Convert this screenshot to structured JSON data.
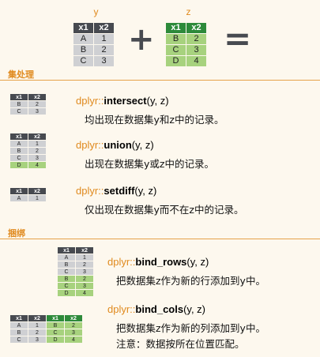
{
  "header": {
    "y_label": "y",
    "z_label": "z",
    "plus": "+",
    "equals": "="
  },
  "y_table": {
    "cols": [
      "x1",
      "x2"
    ],
    "rows": [
      [
        "A",
        "1"
      ],
      [
        "B",
        "2"
      ],
      [
        "C",
        "3"
      ]
    ]
  },
  "z_table": {
    "cols": [
      "x1",
      "x2"
    ],
    "rows": [
      [
        "B",
        "2"
      ],
      [
        "C",
        "3"
      ],
      [
        "D",
        "4"
      ]
    ]
  },
  "sections": {
    "set_ops": "集处理",
    "binding": "捆绑"
  },
  "intersect": {
    "pkg": "dplyr::",
    "name": "intersect",
    "args": "(y, z)",
    "desc": "均出现在数据集y和z中的记录。",
    "cols": [
      "x1",
      "x2"
    ],
    "rows": [
      [
        "B",
        "2"
      ],
      [
        "C",
        "3"
      ]
    ]
  },
  "union": {
    "pkg": "dplyr::",
    "name": "union",
    "args": "(y, z)",
    "desc": "出现在数据集y或z中的记录。",
    "cols": [
      "x1",
      "x2"
    ],
    "rows": [
      [
        "A",
        "1"
      ],
      [
        "B",
        "2"
      ],
      [
        "C",
        "3"
      ],
      [
        "D",
        "4"
      ]
    ]
  },
  "setdiff": {
    "pkg": "dplyr::",
    "name": "setdiff",
    "args": "(y, z)",
    "desc": "仅出现在数据集y而不在z中的记录。",
    "cols": [
      "x1",
      "x2"
    ],
    "rows": [
      [
        "A",
        "1"
      ]
    ]
  },
  "bind_rows": {
    "pkg": "dplyr::",
    "name": "bind_rows",
    "args": "(y, z)",
    "desc": "把数据集z作为新的行添加到y中。",
    "cols": [
      "x1",
      "x2"
    ],
    "rows": [
      [
        "A",
        "1"
      ],
      [
        "B",
        "2"
      ],
      [
        "C",
        "3"
      ],
      [
        "B",
        "2"
      ],
      [
        "C",
        "3"
      ],
      [
        "D",
        "4"
      ]
    ]
  },
  "bind_cols": {
    "pkg": "dplyr::",
    "name": "bind_cols",
    "args": "(y, z)",
    "desc": "把数据集z作为新的列添加到y中。",
    "note": "注意：数据按所在位置匹配。",
    "cols": [
      "x1",
      "x2",
      "x1",
      "x2"
    ],
    "rows": [
      [
        "A",
        "1",
        "B",
        "2"
      ],
      [
        "B",
        "2",
        "C",
        "3"
      ],
      [
        "C",
        "3",
        "D",
        "4"
      ]
    ]
  },
  "colors": {
    "accent": "#e08a1e",
    "gray_header": "#474a50",
    "gray_cell": "#cfd0d3",
    "green_header": "#2d8a3a",
    "green_cell": "#a7d27e"
  }
}
